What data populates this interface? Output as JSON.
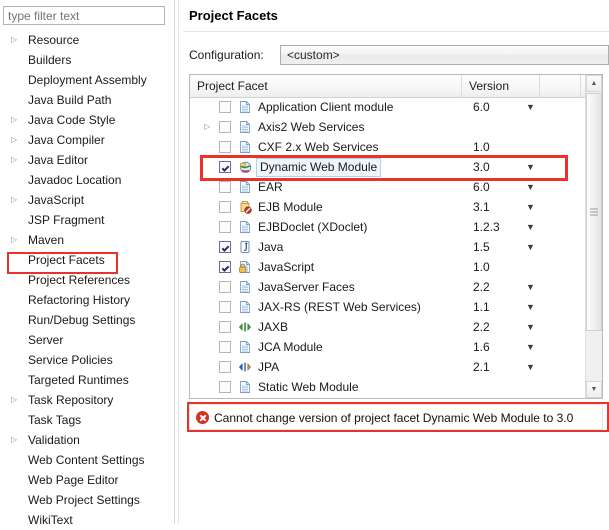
{
  "sidebar": {
    "filter": {
      "placeholder": "type filter text",
      "value": ""
    },
    "items": [
      {
        "label": "Resource",
        "expandable": true
      },
      {
        "label": "Builders",
        "expandable": false
      },
      {
        "label": "Deployment Assembly",
        "expandable": false
      },
      {
        "label": "Java Build Path",
        "expandable": false
      },
      {
        "label": "Java Code Style",
        "expandable": true
      },
      {
        "label": "Java Compiler",
        "expandable": true
      },
      {
        "label": "Java Editor",
        "expandable": true
      },
      {
        "label": "Javadoc Location",
        "expandable": false
      },
      {
        "label": "JavaScript",
        "expandable": true
      },
      {
        "label": "JSP Fragment",
        "expandable": false
      },
      {
        "label": "Maven",
        "expandable": true
      },
      {
        "label": "Project Facets",
        "expandable": false,
        "highlighted": true
      },
      {
        "label": "Project References",
        "expandable": false
      },
      {
        "label": "Refactoring History",
        "expandable": false
      },
      {
        "label": "Run/Debug Settings",
        "expandable": false
      },
      {
        "label": "Server",
        "expandable": false
      },
      {
        "label": "Service Policies",
        "expandable": false
      },
      {
        "label": "Targeted Runtimes",
        "expandable": false
      },
      {
        "label": "Task Repository",
        "expandable": true
      },
      {
        "label": "Task Tags",
        "expandable": false
      },
      {
        "label": "Validation",
        "expandable": true
      },
      {
        "label": "Web Content Settings",
        "expandable": false
      },
      {
        "label": "Web Page Editor",
        "expandable": false
      },
      {
        "label": "Web Project Settings",
        "expandable": false
      },
      {
        "label": "WikiText",
        "expandable": false
      }
    ]
  },
  "main": {
    "title": "Project Facets",
    "configuration": {
      "label": "Configuration:",
      "value": "<custom>"
    },
    "table": {
      "columns": [
        "Project Facet",
        "Version",
        ""
      ],
      "rows": [
        {
          "label": "Application Client module",
          "version": "6.0",
          "checked": false,
          "caret": true,
          "expandable": false,
          "icon": "document-icon",
          "selected": false
        },
        {
          "label": "Axis2 Web Services",
          "version": "",
          "checked": false,
          "caret": false,
          "expandable": true,
          "icon": "document-icon",
          "selected": false
        },
        {
          "label": "CXF 2.x Web Services",
          "version": "1.0",
          "checked": false,
          "caret": false,
          "expandable": false,
          "icon": "document-icon",
          "selected": false
        },
        {
          "label": "Dynamic Web Module",
          "version": "3.0",
          "checked": true,
          "caret": true,
          "expandable": false,
          "icon": "globe-icon",
          "selected": true
        },
        {
          "label": "EAR",
          "version": "6.0",
          "checked": false,
          "caret": true,
          "expandable": false,
          "icon": "document-icon",
          "selected": false
        },
        {
          "label": "EJB Module",
          "version": "3.1",
          "checked": false,
          "caret": true,
          "expandable": false,
          "icon": "ejb-icon",
          "selected": false
        },
        {
          "label": "EJBDoclet (XDoclet)",
          "version": "1.2.3",
          "checked": false,
          "caret": true,
          "expandable": false,
          "icon": "document-icon",
          "selected": false
        },
        {
          "label": "Java",
          "version": "1.5",
          "checked": true,
          "caret": true,
          "expandable": false,
          "icon": "java-icon",
          "selected": false
        },
        {
          "label": "JavaScript",
          "version": "1.0",
          "checked": true,
          "caret": false,
          "expandable": false,
          "icon": "javascript-icon",
          "selected": false
        },
        {
          "label": "JavaServer Faces",
          "version": "2.2",
          "checked": false,
          "caret": true,
          "expandable": false,
          "icon": "document-icon",
          "selected": false
        },
        {
          "label": "JAX-RS (REST Web Services)",
          "version": "1.1",
          "checked": false,
          "caret": true,
          "expandable": false,
          "icon": "document-icon",
          "selected": false
        },
        {
          "label": "JAXB",
          "version": "2.2",
          "checked": false,
          "caret": true,
          "expandable": false,
          "icon": "jaxb-icon",
          "selected": false
        },
        {
          "label": "JCA Module",
          "version": "1.6",
          "checked": false,
          "caret": true,
          "expandable": false,
          "icon": "document-icon",
          "selected": false
        },
        {
          "label": "JPA",
          "version": "2.1",
          "checked": false,
          "caret": true,
          "expandable": false,
          "icon": "jpa-icon",
          "selected": false
        },
        {
          "label": "Static Web Module",
          "version": "",
          "checked": false,
          "caret": false,
          "expandable": false,
          "icon": "document-icon",
          "selected": false
        }
      ]
    },
    "error": {
      "icon": "error-icon",
      "text": "Cannot change version of project facet Dynamic Web Module to 3.0"
    }
  },
  "colors": {
    "highlight_box": "#e8332a",
    "error_red": "#d93025",
    "selection_blue": "#b9cfe6"
  }
}
